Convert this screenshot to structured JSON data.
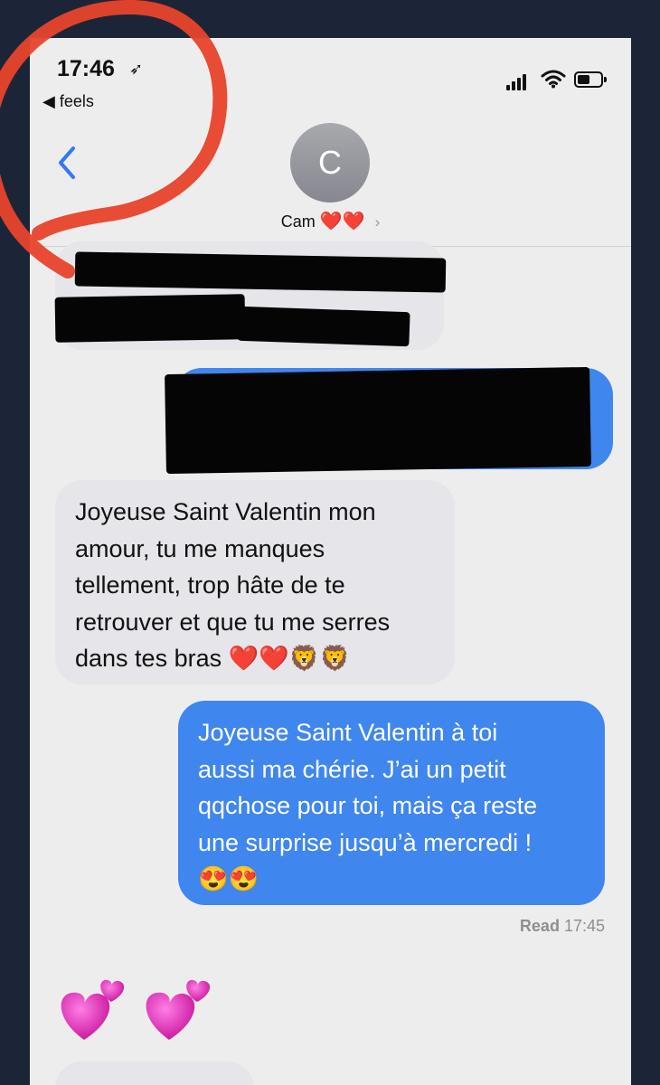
{
  "status_bar": {
    "time": "17:46",
    "back_app": "◀ feels",
    "location_icon": "location-arrow-icon",
    "signal_icon": "cellular-signal-icon",
    "wifi_icon": "wifi-icon",
    "battery_icon": "battery-icon"
  },
  "header": {
    "avatar_initial": "C",
    "contact_name": "Cam",
    "name_hearts": "❤️❤️",
    "chevron": "›"
  },
  "messages": [
    {
      "direction": "incoming",
      "lines": [
        "Joyeuse Saint Valentin mon",
        "amour, tu me manques",
        "tellement, trop hâte de te",
        "retrouver et que tu me serres",
        "dans tes bras ❤️❤️🦁🦁"
      ]
    },
    {
      "direction": "outgoing",
      "lines": [
        "Joyeuse Saint Valentin à toi",
        "aussi  ma chérie. J’ai un petit",
        "qqchose pour toi, mais ça reste",
        "une surprise jusqu’à mercredi !",
        "😍😍"
      ]
    }
  ],
  "read_receipt": {
    "label": "Read",
    "time": "17:45"
  },
  "reaction_emoji": "💕💕",
  "colors": {
    "outgoing_bubble": "#3f86ef",
    "incoming_bubble": "#e5e5ea",
    "ios_blue": "#3478f6",
    "annotation_red": "#e8432b"
  }
}
